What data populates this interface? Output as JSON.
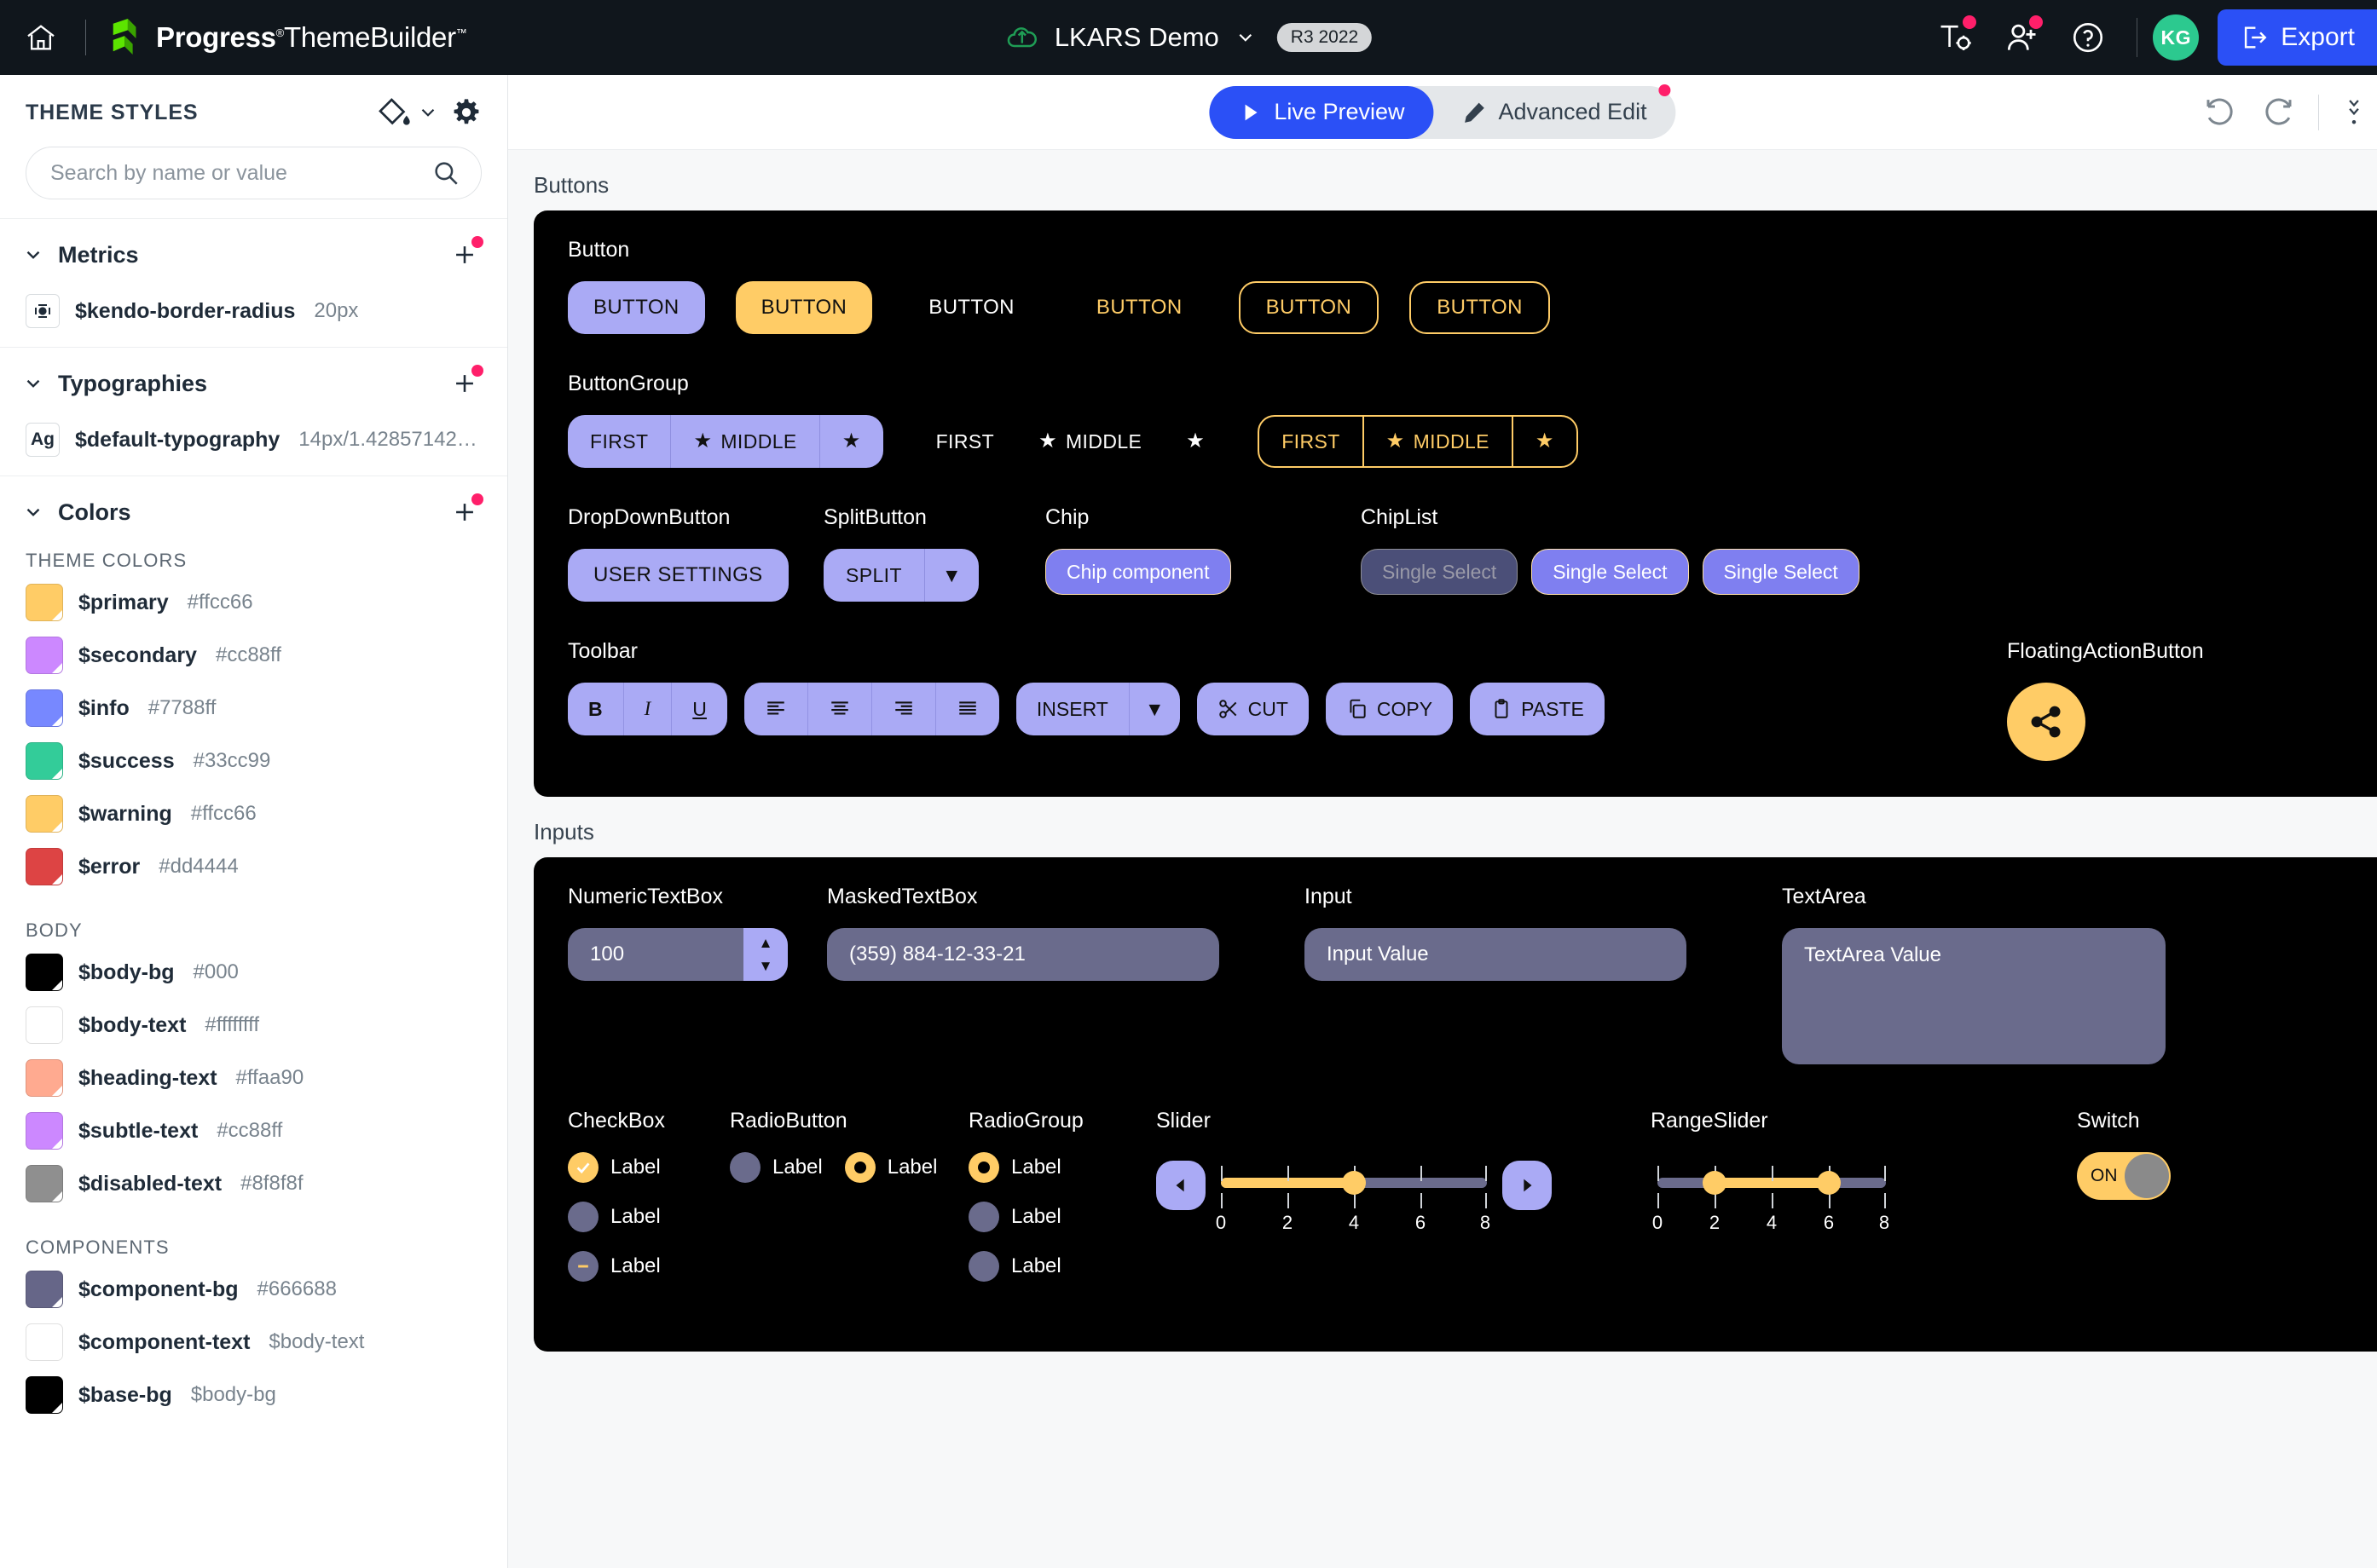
{
  "topbar": {
    "home_icon": "home-icon",
    "brand_bold": "Progress",
    "brand_reg": "ThemeBuilder",
    "brand_sup_r": "®",
    "brand_sup_tm": "™",
    "project_name": "LKARS Demo",
    "version_badge": "R3 2022",
    "icons": [
      "typography-settings-icon",
      "add-user-icon",
      "help-icon"
    ],
    "avatar_initials": "KG",
    "export_label": "Export",
    "accent_blue": "#2b50f6",
    "badge_pink": "#ff1f6a",
    "avatar_green": "#2cc98f"
  },
  "sidebar": {
    "title": "THEME STYLES",
    "paint_icon": "paint-bucket-icon",
    "chevron_icon": "chevron-down-icon",
    "gear_icon": "gear-icon",
    "search": {
      "placeholder": "Search by name or value",
      "value": "",
      "icon": "search-icon"
    },
    "sections": [
      {
        "title": "Metrics",
        "add_icon": "plus-icon"
      },
      {
        "title": "Typographies",
        "add_icon": "plus-icon"
      },
      {
        "title": "Colors",
        "add_icon": "plus-icon"
      }
    ],
    "metrics": [
      {
        "icon": "border-radius-icon",
        "name": "$kendo-border-radius",
        "value": "20px"
      }
    ],
    "typographies": [
      {
        "icon": "Ag",
        "name": "$default-typography",
        "value": "14px/1.42857142…"
      }
    ],
    "color_groups": [
      {
        "label": "THEME COLORS",
        "items": [
          {
            "name": "$primary",
            "value": "#ffcc66",
            "swatch": "#ffcc66"
          },
          {
            "name": "$secondary",
            "value": "#cc88ff",
            "swatch": "#cc88ff"
          },
          {
            "name": "$info",
            "value": "#7788ff",
            "swatch": "#7788ff"
          },
          {
            "name": "$success",
            "value": "#33cc99",
            "swatch": "#33cc99"
          },
          {
            "name": "$warning",
            "value": "#ffcc66",
            "swatch": "#ffcc66"
          },
          {
            "name": "$error",
            "value": "#dd4444",
            "swatch": "#dd4444"
          }
        ]
      },
      {
        "label": "BODY",
        "items": [
          {
            "name": "$body-bg",
            "value": "#000",
            "swatch": "#000000"
          },
          {
            "name": "$body-text",
            "value": "#ffffffff",
            "swatch": "#ffffff"
          },
          {
            "name": "$heading-text",
            "value": "#ffaa90",
            "swatch": "#ffaa90"
          },
          {
            "name": "$subtle-text",
            "value": "#cc88ff",
            "swatch": "#cc88ff"
          },
          {
            "name": "$disabled-text",
            "value": "#8f8f8f",
            "swatch": "#8f8f8f"
          }
        ]
      },
      {
        "label": "COMPONENTS",
        "items": [
          {
            "name": "$component-bg",
            "value": "#666688",
            "swatch": "#666688"
          },
          {
            "name": "$component-text",
            "value": "$body-text",
            "swatch": "#ffffff"
          },
          {
            "name": "$base-bg",
            "value": "$body-bg",
            "swatch": "#000000"
          }
        ]
      }
    ]
  },
  "main_toolbar": {
    "live_preview": "Live Preview",
    "advanced_edit": "Advanced Edit",
    "play_icon": "play-icon",
    "pencil_icon": "pencil-icon",
    "undo_icon": "undo-icon",
    "redo_icon": "redo-icon",
    "more_icon": "more-vertical-icon"
  },
  "preview": {
    "sections": [
      {
        "id": "buttons",
        "title": "Buttons"
      },
      {
        "id": "inputs",
        "title": "Inputs"
      }
    ],
    "buttons": {
      "label": "Button",
      "items": [
        {
          "text": "BUTTON",
          "variant": "base"
        },
        {
          "text": "BUTTON",
          "variant": "primary"
        },
        {
          "text": "BUTTON",
          "variant": "flat"
        },
        {
          "text": "BUTTON",
          "variant": "flat-p"
        },
        {
          "text": "BUTTON",
          "variant": "outline"
        },
        {
          "text": "BUTTON",
          "variant": "outline"
        }
      ]
    },
    "button_group": {
      "label": "ButtonGroup",
      "first": "FIRST",
      "middle": "MIDDLE",
      "star_icon": "star-icon"
    },
    "dropdown_button": {
      "label": "DropDownButton",
      "text": "USER SETTINGS"
    },
    "split_button": {
      "label": "SplitButton",
      "text": "SPLIT",
      "arrow_icon": "caret-down-icon"
    },
    "chip": {
      "label": "Chip",
      "text": "Chip component"
    },
    "chip_list": {
      "label": "ChipList",
      "items": [
        "Single Select",
        "Single Select",
        "Single Select"
      ]
    },
    "toolbar": {
      "label": "Toolbar",
      "format": [
        "B",
        "I",
        "U"
      ],
      "align_icons": [
        "align-left-icon",
        "align-center-icon",
        "align-right-icon",
        "align-justify-icon"
      ],
      "insert": "INSERT",
      "insert_arrow": "caret-down-icon",
      "cut": "CUT",
      "cut_icon": "scissors-icon",
      "copy": "COPY",
      "copy_icon": "copy-icon",
      "paste": "PASTE",
      "paste_icon": "clipboard-icon"
    },
    "fab": {
      "label": "FloatingActionButton",
      "icon": "share-icon"
    },
    "numeric_textbox": {
      "label": "NumericTextBox",
      "value": "100",
      "up_icon": "caret-up-icon",
      "down_icon": "caret-down-icon"
    },
    "masked_textbox": {
      "label": "MaskedTextBox",
      "value": "(359) 884-12-33-21"
    },
    "input": {
      "label": "Input",
      "value": "Input Value"
    },
    "textarea": {
      "label": "TextArea",
      "value": "TextArea Value"
    },
    "checkbox": {
      "label": "CheckBox",
      "items": [
        {
          "text": "Label",
          "state": "checked"
        },
        {
          "text": "Label",
          "state": "unchecked"
        },
        {
          "text": "Label",
          "state": "indeterminate"
        }
      ]
    },
    "radiobutton": {
      "label": "RadioButton",
      "items": [
        {
          "text": "Label",
          "state": "off"
        },
        {
          "text": "Label",
          "state": "on"
        }
      ]
    },
    "radiogroup": {
      "label": "RadioGroup",
      "items": [
        {
          "text": "Label",
          "state": "on"
        },
        {
          "text": "Label",
          "state": "off"
        },
        {
          "text": "Label",
          "state": "off"
        }
      ]
    },
    "slider": {
      "label": "Slider",
      "ticks": [
        "0",
        "2",
        "4",
        "6",
        "8"
      ],
      "min": 0,
      "max": 8,
      "value": 4,
      "dec_icon": "caret-left-icon",
      "inc_icon": "caret-right-icon"
    },
    "range_slider": {
      "label": "RangeSlider",
      "ticks": [
        "0",
        "2",
        "4",
        "6",
        "8"
      ],
      "min": 0,
      "max": 8,
      "start": 2,
      "end": 6
    },
    "switch": {
      "label": "Switch",
      "state_text": "ON",
      "on": true
    }
  },
  "chart_data": null
}
